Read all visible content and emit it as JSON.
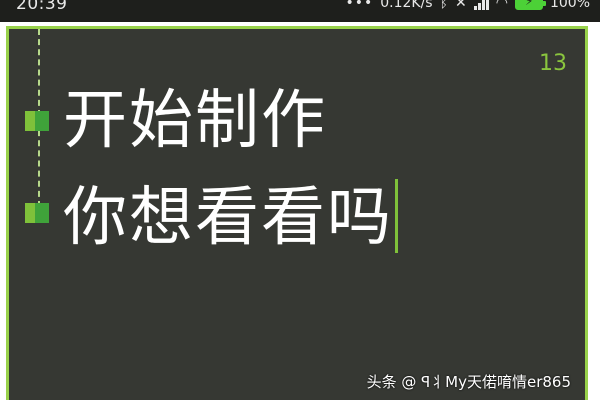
{
  "status_bar": {
    "time": "20:39",
    "network_speed": "0.12K/s",
    "battery_percent": "100%",
    "icons": [
      "more-dots-icon",
      "bluetooth-icon",
      "mute-icon",
      "signal-icon",
      "wifi-icon",
      "battery-charging-icon"
    ]
  },
  "editor": {
    "line_count": "13",
    "lines": [
      "开始制作",
      "你想看看吗"
    ],
    "accent_color": "#98d14a",
    "background_color": "#363833"
  },
  "watermark": "头条 @ ꟼ丬My天偌唷情er865"
}
